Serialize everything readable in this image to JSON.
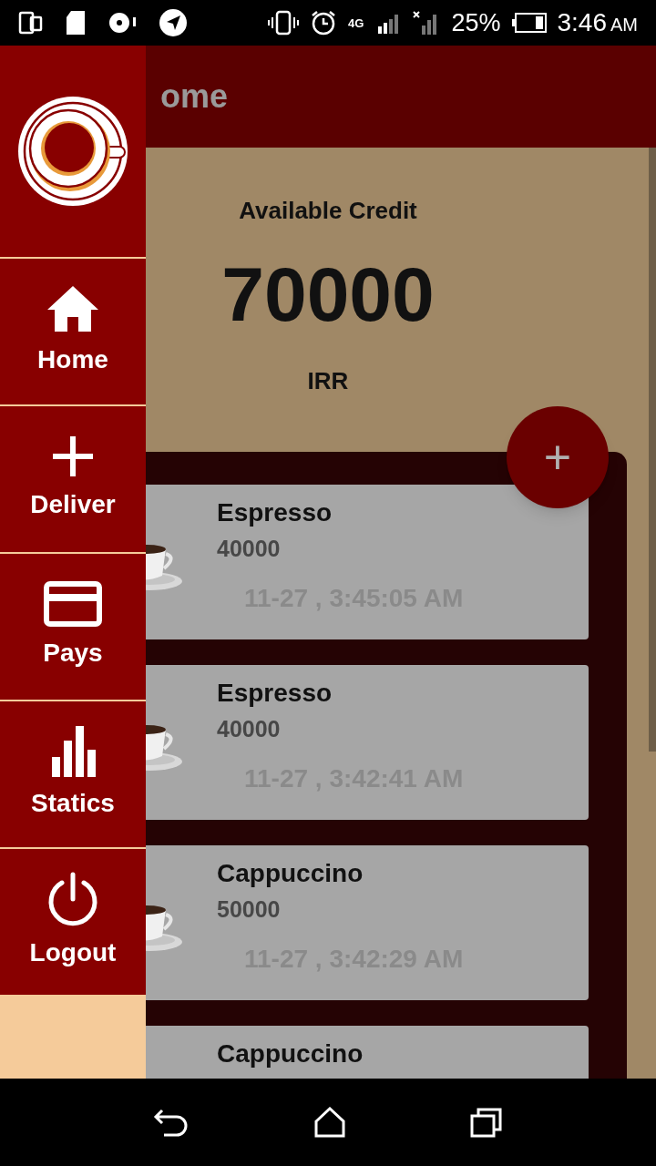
{
  "status_bar": {
    "network": "4G",
    "battery": "25%",
    "time": "3:46",
    "ampm": "AM"
  },
  "app_bar": {
    "title": "ome"
  },
  "credit": {
    "label": "Available Credit",
    "amount": "70000",
    "currency": "IRR"
  },
  "fab": {
    "label": "+"
  },
  "orders": [
    {
      "name": "Espresso",
      "price": "40000",
      "time": "11-27 , 3:45:05 AM"
    },
    {
      "name": "Espresso",
      "price": "40000",
      "time": "11-27 , 3:42:41 AM"
    },
    {
      "name": "Cappuccino",
      "price": "50000",
      "time": "11-27 , 3:42:29 AM"
    },
    {
      "name": "Cappuccino"
    }
  ],
  "drawer": {
    "items": [
      {
        "kind": "home",
        "label": "Home"
      },
      {
        "kind": "deliver",
        "label": "Deliver"
      },
      {
        "kind": "pays",
        "label": "Pays"
      },
      {
        "kind": "statics",
        "label": "Statics"
      },
      {
        "kind": "logout",
        "label": "Logout"
      }
    ]
  }
}
